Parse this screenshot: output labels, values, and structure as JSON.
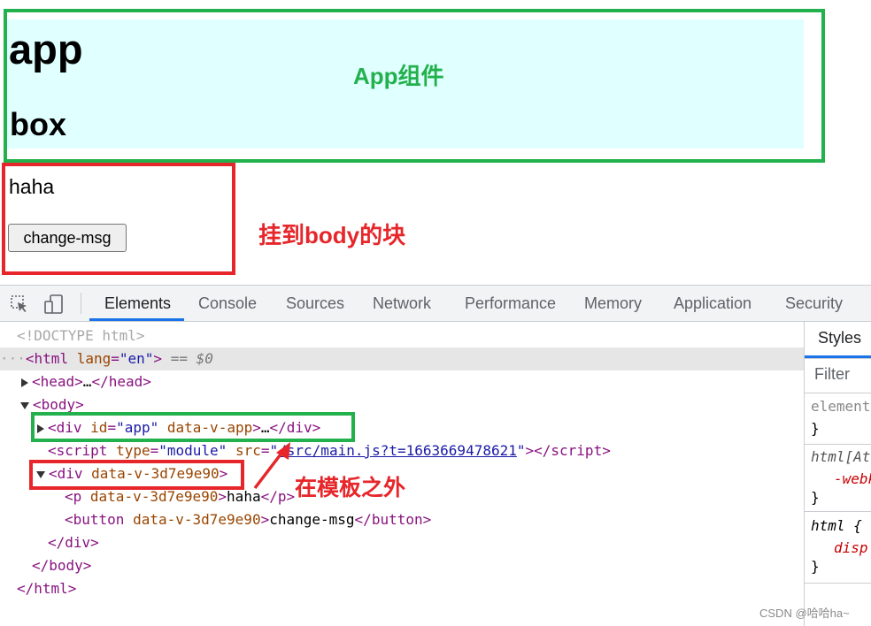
{
  "page": {
    "app_heading": "app",
    "box_heading": "box",
    "paragraph": "haha",
    "button_label": "change-msg"
  },
  "annotations": {
    "app_component": "App组件",
    "mounted_body": "挂到body的块",
    "outside_template": "在模板之外"
  },
  "devtools": {
    "tabs": [
      "Elements",
      "Console",
      "Sources",
      "Network",
      "Performance",
      "Memory",
      "Application",
      "Security"
    ],
    "active_tab": "Elements",
    "styles_tab": "Styles",
    "filter_placeholder": "Filter",
    "doctype": "<!DOCTYPE html>",
    "dollar": "== $0",
    "script_src": "/src/main.js?t=1663669478621",
    "styles_lines": [
      "element",
      "}",
      "html[At",
      "-webk",
      "}",
      "html {",
      "disp",
      "}"
    ]
  },
  "watermark": "CSDN @哈哈ha~",
  "colors": {
    "green": "#22b14c",
    "red": "#e6262a",
    "app_bg": "#e0ffff",
    "accent": "#1a73e8"
  }
}
